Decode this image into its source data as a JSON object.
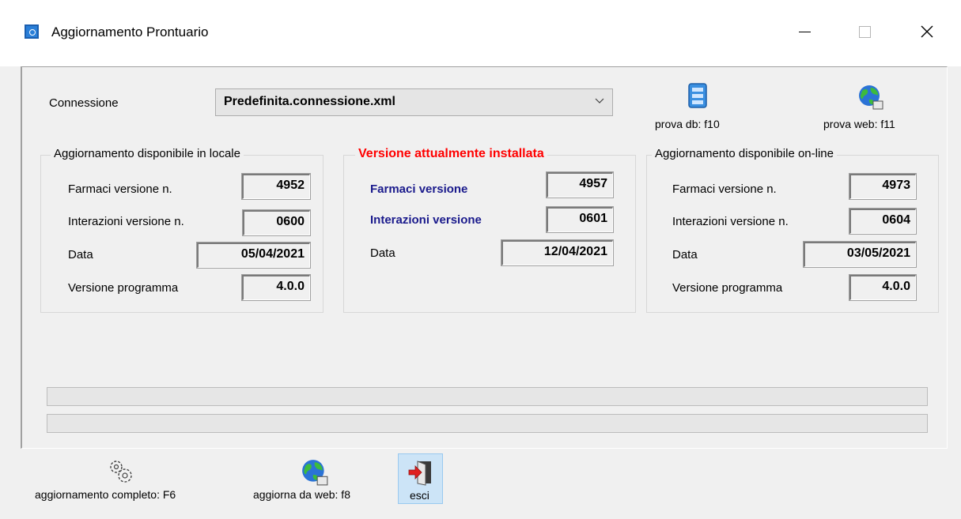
{
  "window": {
    "title": "Aggiornamento Prontuario",
    "controls": [
      "minimize",
      "maximize",
      "close"
    ]
  },
  "connection": {
    "label": "Connessione",
    "selected": "Predefinita.connessione.xml"
  },
  "tools": {
    "test_db": "prova db: f10",
    "test_web": "prova web: f11"
  },
  "groups": {
    "local": {
      "title": "Aggiornamento disponibile in locale",
      "farmaci_label": "Farmaci versione n.",
      "farmaci_value": "4952",
      "interazioni_label": "Interazioni versione n.",
      "interazioni_value": "0600",
      "data_label": "Data",
      "data_value": "05/04/2021",
      "programma_label": "Versione programma",
      "programma_value": "4.0.0"
    },
    "installed": {
      "title": "Versione attualmente installata",
      "farmaci_label": "Farmaci versione",
      "farmaci_value": "4957",
      "interazioni_label": "Interazioni versione",
      "interazioni_value": "0601",
      "data_label": "Data",
      "data_value": "12/04/2021"
    },
    "online": {
      "title": "Aggiornamento disponibile on-line",
      "farmaci_label": "Farmaci versione n.",
      "farmaci_value": "4973",
      "interazioni_label": "Interazioni versione n.",
      "interazioni_value": "0604",
      "data_label": "Data",
      "data_value": "03/05/2021",
      "programma_label": "Versione programma",
      "programma_value": "4.0.0"
    }
  },
  "progress": {
    "bar1": 0,
    "bar2": 0
  },
  "bottom_buttons": {
    "full_update": "aggiornamento completo: F6",
    "web_update": "aggiorna da web: f8",
    "exit": "esci"
  },
  "colors": {
    "installed_title": "#ff0000",
    "installed_labels": "#1a1a8c",
    "title_bar": "#ffffff",
    "window_bg": "#f0f0f0"
  }
}
